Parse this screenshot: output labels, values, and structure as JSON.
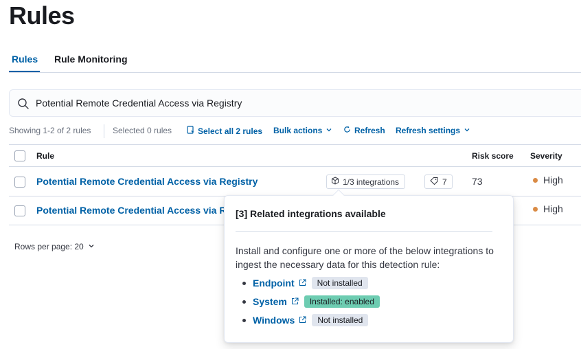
{
  "page": {
    "title": "Rules"
  },
  "tabs": [
    {
      "label": "Rules",
      "active": true
    },
    {
      "label": "Rule Monitoring",
      "active": false
    }
  ],
  "search": {
    "value": "Potential Remote Credential Access via Registry"
  },
  "utility_bar": {
    "showing": "Showing 1-2 of 2 rules",
    "selected": "Selected 0 rules",
    "select_all": "Select all 2 rules",
    "bulk_actions": "Bulk actions",
    "refresh": "Refresh",
    "refresh_settings": "Refresh settings"
  },
  "table": {
    "columns": {
      "rule": "Rule",
      "risk_score": "Risk score",
      "severity": "Severity"
    },
    "rows": [
      {
        "name": "Potential Remote Credential Access via Registry",
        "integrations": "1/3 integrations",
        "tags": "7",
        "risk_score": "73",
        "severity": "High"
      },
      {
        "name": "Potential Remote Credential Access via Registry",
        "severity": "High"
      }
    ]
  },
  "pagination": {
    "rows_per_page": "Rows per page: 20"
  },
  "popover": {
    "title": "[3] Related integrations available",
    "description": "Install and configure one or more of the below integrations to ingest the necessary data for this detection rule:",
    "integrations": [
      {
        "name": "Endpoint",
        "status": "Not installed"
      },
      {
        "name": "System",
        "status": "Installed: enabled"
      },
      {
        "name": "Windows",
        "status": "Not installed"
      }
    ]
  },
  "colors": {
    "link": "#0061a6",
    "severity_high": "#da8b45",
    "status_enabled": "#6dccb1",
    "status_not_installed": "#e0e5ee"
  }
}
